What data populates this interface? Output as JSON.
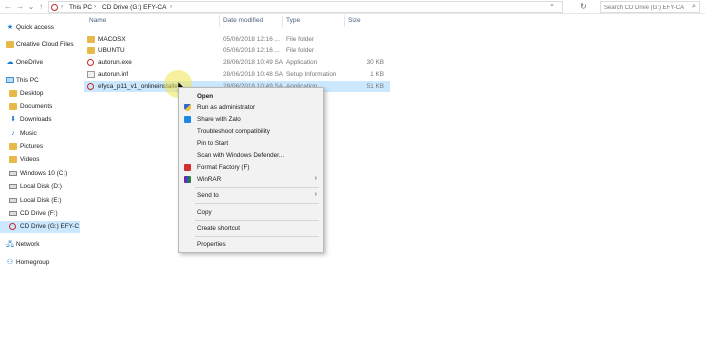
{
  "addressbar": {
    "crumbs": [
      "This PC",
      "CD Drive (G:) EFY-CA"
    ],
    "search_placeholder": "Search CD Drive (G:) EFY-CA"
  },
  "navpane": {
    "items": [
      {
        "label": "Quick access",
        "icon": "star-icon"
      },
      {
        "label": "Creative Cloud Files",
        "icon": "folder-icon"
      },
      {
        "label": "OneDrive",
        "icon": "cloud-icon"
      },
      {
        "label": "This PC",
        "icon": "computer-icon"
      },
      {
        "label": "Desktop",
        "icon": "folder-icon"
      },
      {
        "label": "Documents",
        "icon": "folder-icon"
      },
      {
        "label": "Downloads",
        "icon": "download-icon"
      },
      {
        "label": "Music",
        "icon": "music-icon"
      },
      {
        "label": "Pictures",
        "icon": "folder-icon"
      },
      {
        "label": "Videos",
        "icon": "folder-icon"
      },
      {
        "label": "Windows 10 (C:)",
        "icon": "drive-icon"
      },
      {
        "label": "Local Disk (D:)",
        "icon": "drive-icon"
      },
      {
        "label": "Local Disk (E:)",
        "icon": "drive-icon"
      },
      {
        "label": "CD Drive (F:)",
        "icon": "drive-icon"
      },
      {
        "label": "CD Drive (G:) EFY-C",
        "icon": "cd-icon"
      },
      {
        "label": "Network",
        "icon": "network-icon"
      },
      {
        "label": "Homegroup",
        "icon": "homegroup-icon"
      }
    ]
  },
  "columns": {
    "name": "Name",
    "date": "Date modified",
    "type": "Type",
    "size": "Size"
  },
  "files": [
    {
      "name": "MACOSX",
      "date": "05/06/2018 12:16 ...",
      "type": "File folder",
      "size": ""
    },
    {
      "name": "UBUNTU",
      "date": "05/06/2018 12:16 ...",
      "type": "File folder",
      "size": ""
    },
    {
      "name": "autorun.exe",
      "date": "28/06/2018 10:49 SA",
      "type": "Application",
      "size": "30 KB"
    },
    {
      "name": "autorun.inf",
      "date": "28/06/2018 10:48 SA",
      "type": "Setup Information",
      "size": "1 KB"
    },
    {
      "name": "efyca_p11_v1_onlineinstaller",
      "date": "28/06/2018 10:49 SA",
      "type": "Application",
      "size": "51 KB"
    }
  ],
  "context_menu": {
    "items": [
      {
        "label": "Open",
        "bold": true
      },
      {
        "label": "Run as administrator",
        "icon": "shield-icon"
      },
      {
        "label": "Share with Zalo",
        "icon": "zalo-icon"
      },
      {
        "label": "Troubleshoot compatibility"
      },
      {
        "label": "Pin to Start"
      },
      {
        "label": "Scan with Windows Defender..."
      },
      {
        "label": "Format Factory (F)",
        "icon": "format-factory-icon"
      },
      {
        "label": "WinRAR",
        "icon": "winrar-icon",
        "submenu": true
      },
      {
        "label": "Send to",
        "submenu": true
      },
      {
        "label": "Copy"
      },
      {
        "label": "Create shortcut"
      },
      {
        "label": "Properties"
      }
    ]
  }
}
